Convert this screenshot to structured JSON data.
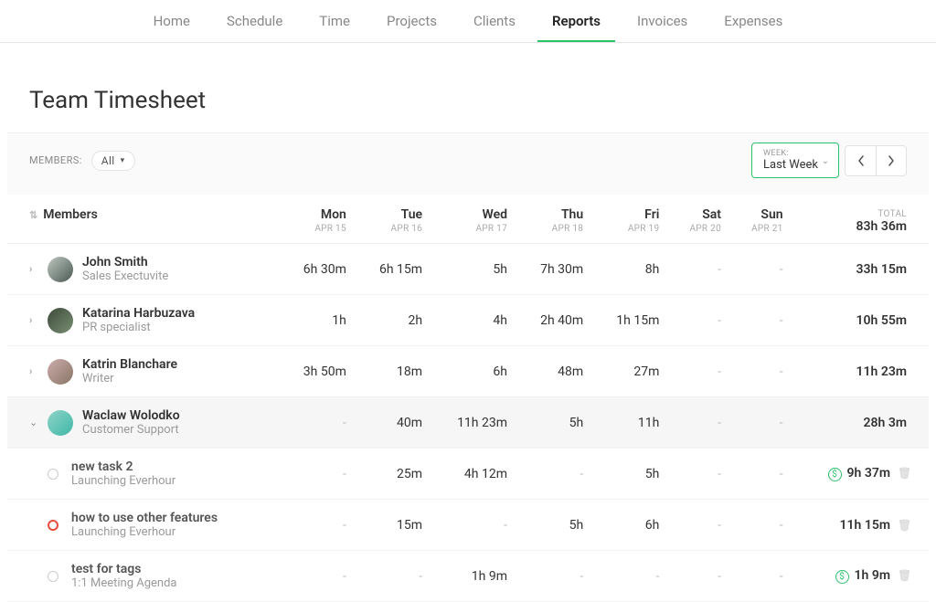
{
  "nav": {
    "items": [
      "Home",
      "Schedule",
      "Time",
      "Projects",
      "Clients",
      "Reports",
      "Invoices",
      "Expenses"
    ],
    "active": "Reports"
  },
  "page_title": "Team Timesheet",
  "filters": {
    "members_label": "MEMBERS:",
    "members_value": "All",
    "week_label": "WEEK:",
    "week_value": "Last Week"
  },
  "table": {
    "members_header": "Members",
    "days": [
      {
        "dow": "Mon",
        "date": "APR 15"
      },
      {
        "dow": "Tue",
        "date": "APR 16"
      },
      {
        "dow": "Wed",
        "date": "APR 17"
      },
      {
        "dow": "Thu",
        "date": "APR 18"
      },
      {
        "dow": "Fri",
        "date": "APR 19"
      },
      {
        "dow": "Sat",
        "date": "APR 20"
      },
      {
        "dow": "Sun",
        "date": "APR 21"
      }
    ],
    "total_label": "TOTAL",
    "grand_total": "83h 36m",
    "members": [
      {
        "name": "John Smith",
        "role": "Sales Exectuvite",
        "cells": [
          "6h 30m",
          "6h 15m",
          "5h",
          "7h 30m",
          "8h",
          "-",
          "-"
        ],
        "total": "33h 15m",
        "expanded": false
      },
      {
        "name": "Katarina Harbuzava",
        "role": "PR specialist",
        "cells": [
          "1h",
          "2h",
          "4h",
          "2h 40m",
          "1h 15m",
          "-",
          "-"
        ],
        "total": "10h 55m",
        "expanded": false
      },
      {
        "name": "Katrin Blanchare",
        "role": "Writer",
        "cells": [
          "3h 50m",
          "18m",
          "6h",
          "48m",
          "27m",
          "-",
          "-"
        ],
        "total": "11h 23m",
        "expanded": false
      },
      {
        "name": "Waclaw Wolodko",
        "role": "Customer Support",
        "cells": [
          "-",
          "40m",
          "11h 23m",
          "5h",
          "11h",
          "-",
          "-"
        ],
        "total": "28h 3m",
        "expanded": true,
        "tasks": [
          {
            "name": "new task 2",
            "project": "Launching Everhour",
            "status": "open",
            "cells": [
              "-",
              "25m",
              "4h 12m",
              "-",
              "5h",
              "-",
              "-"
            ],
            "total": "9h 37m",
            "billable": true
          },
          {
            "name": "how to use other features",
            "project": "Launching Everhour",
            "status": "blocked",
            "cells": [
              "-",
              "15m",
              "-",
              "5h",
              "6h",
              "-",
              "-"
            ],
            "total": "11h 15m",
            "billable": false
          },
          {
            "name": "test for tags",
            "project": "1:1 Meeting Agenda",
            "status": "open",
            "cells": [
              "-",
              "-",
              "1h 9m",
              "-",
              "-",
              "-",
              "-"
            ],
            "total": "1h 9m",
            "billable": true
          }
        ]
      }
    ]
  }
}
